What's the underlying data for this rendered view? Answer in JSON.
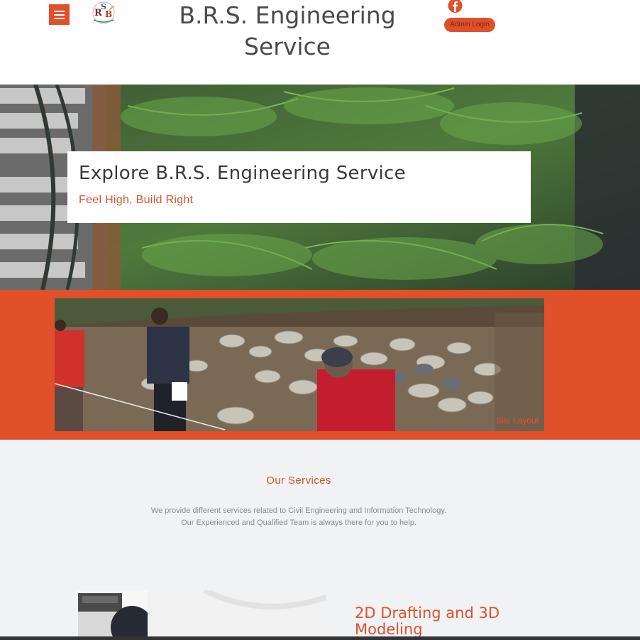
{
  "header": {
    "site_title": "B.R.S. Engineering Service",
    "admin_label": "Admin Login",
    "menu_icon": "hamburger-icon",
    "social_icon": "facebook-icon"
  },
  "hero": {
    "title": "Explore B.R.S. Engineering Service",
    "subtitle": "Feel High, Build Right"
  },
  "site_photo": {
    "caption": "Site Layout"
  },
  "services": {
    "title": "Our Services",
    "description_line1": "We provide different services related to Civil Engineering and Information Technology.",
    "description_line2": "Our Experienced and Qualified Team is always there for you to help.",
    "first_service_title": "2D Drafting and 3D Modeling"
  },
  "colors": {
    "accent": "#e0502b",
    "background": "#f1f2f4",
    "title_text": "#4a4a4a"
  }
}
